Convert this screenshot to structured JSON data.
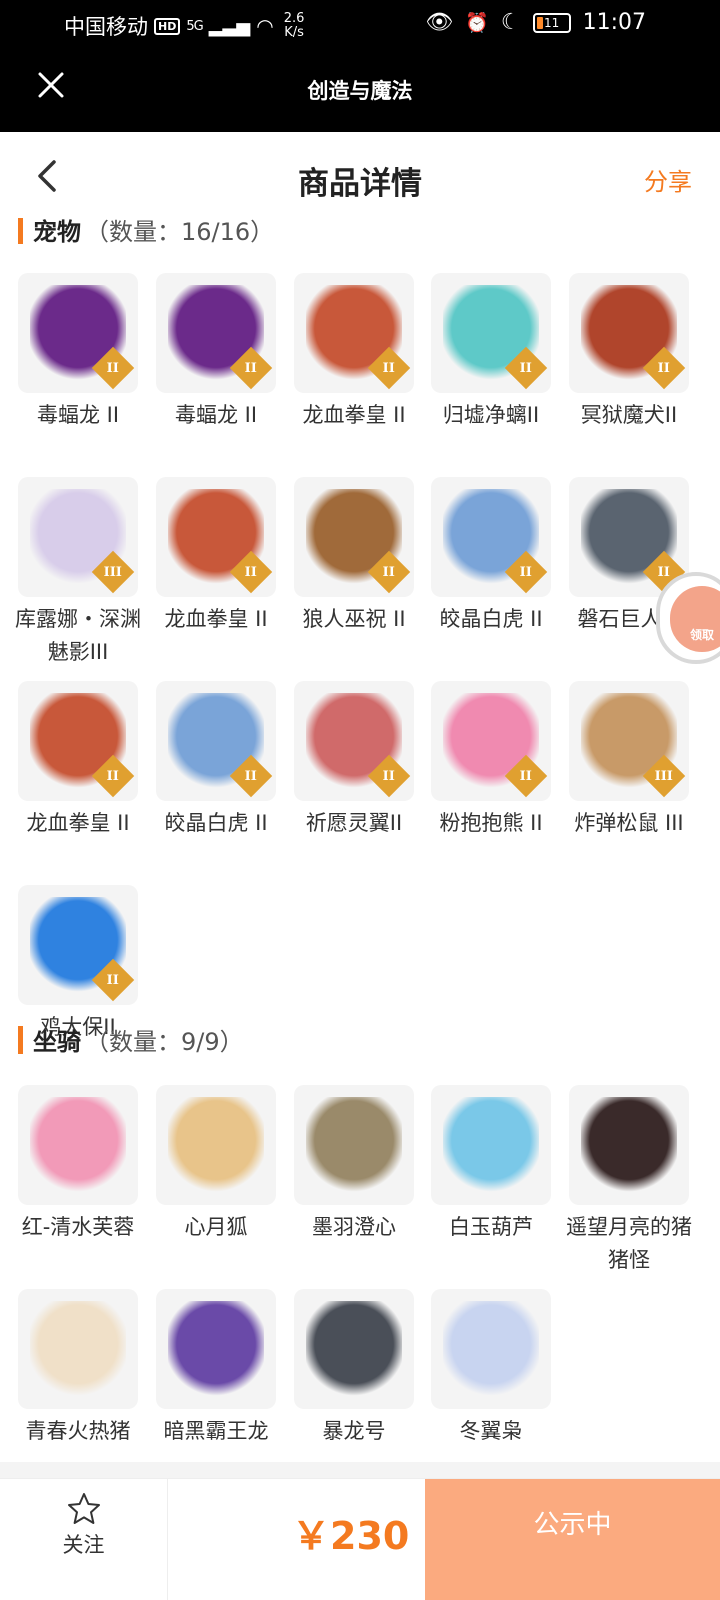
{
  "status_bar": {
    "carrier": "中国移动",
    "hd": "HD",
    "signal": "5G",
    "speed_top": "2.6",
    "speed_bottom": "K/s",
    "battery": "11",
    "time": "11:07"
  },
  "app_header": {
    "title": "创造与魔法",
    "close_icon": "close-icon"
  },
  "page_header": {
    "title": "商品详情",
    "share_label": "分享",
    "back_icon": "chevron-left-icon"
  },
  "sections": {
    "pets": {
      "name": "宠物",
      "count": "（数量：16/16）"
    },
    "mounts": {
      "name": "坐骑",
      "count": "（数量：9/9）"
    }
  },
  "pets": [
    {
      "label": "毒蝠龙 II",
      "badge": "II",
      "color": "#6b2a8a"
    },
    {
      "label": "毒蝠龙 II",
      "badge": "II",
      "color": "#6b2a8a"
    },
    {
      "label": "龙血拳皇 II",
      "badge": "II",
      "color": "#c8583a"
    },
    {
      "label": "归墟净螭II",
      "badge": "II",
      "color": "#5ec9c8"
    },
    {
      "label": "冥狱魔犬II",
      "badge": "II",
      "color": "#b0452c"
    },
    {
      "label": "库露娜・深渊魅影III",
      "badge": "III",
      "color": "#d8cdea"
    },
    {
      "label": "龙血拳皇 II",
      "badge": "II",
      "color": "#c8583a"
    },
    {
      "label": "狼人巫祝 II",
      "badge": "II",
      "color": "#a06a3a"
    },
    {
      "label": "皎晶白虎 II",
      "badge": "II",
      "color": "#7aa4d8"
    },
    {
      "label": "磐石巨人 II",
      "badge": "II",
      "color": "#5a6470"
    },
    {
      "label": "龙血拳皇 II",
      "badge": "II",
      "color": "#c8583a"
    },
    {
      "label": "皎晶白虎 II",
      "badge": "II",
      "color": "#7aa4d8"
    },
    {
      "label": "祈愿灵翼II",
      "badge": "II",
      "color": "#d06a6a"
    },
    {
      "label": "粉抱抱熊 II",
      "badge": "II",
      "color": "#f08ab0"
    },
    {
      "label": "炸弹松鼠 III",
      "badge": "III",
      "color": "#c89a68"
    },
    {
      "label": "鸡大保II",
      "badge": "II",
      "color": "#2f82e0"
    }
  ],
  "mounts": [
    {
      "label": "红-清水芙蓉",
      "color": "#f29ab8"
    },
    {
      "label": "心月狐",
      "color": "#e8c48a"
    },
    {
      "label": "墨羽澄心",
      "color": "#9a8a6a"
    },
    {
      "label": "白玉葫芦",
      "color": "#7ac8e8"
    },
    {
      "label": "遥望月亮的猪猪怪",
      "color": "#3a2a2a"
    },
    {
      "label": "青春火热猪",
      "color": "#f0e0c8"
    },
    {
      "label": "暗黑霸王龙",
      "color": "#6a4aa8"
    },
    {
      "label": "暴龙号",
      "color": "#4a4f58"
    },
    {
      "label": "冬翼枭",
      "color": "#c8d4f0"
    }
  ],
  "side_badge": {
    "label": "领取"
  },
  "bottom_bar": {
    "follow_label": "关注",
    "follow_icon": "star-icon",
    "price": "￥230",
    "status_label": "公示中"
  },
  "colors": {
    "accent": "#f47a20",
    "status_button": "#fbaa7f"
  }
}
